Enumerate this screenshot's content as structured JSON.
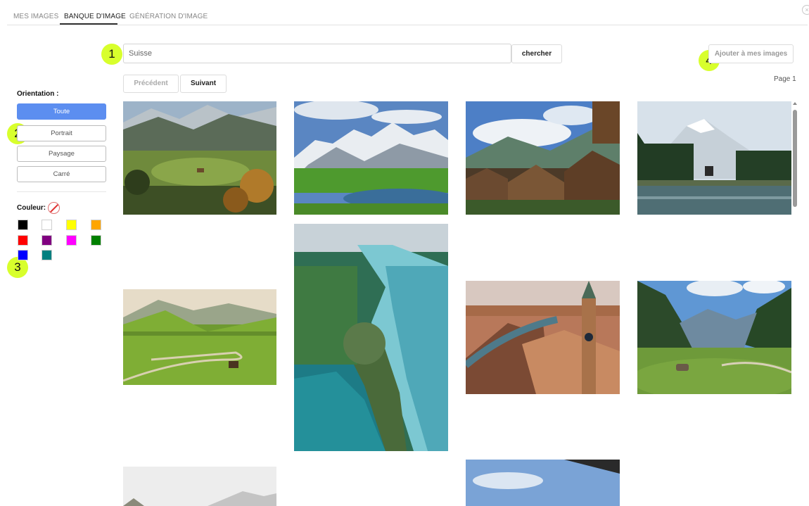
{
  "tabs": [
    {
      "label": "MES IMAGES"
    },
    {
      "label": "BANQUE D'IMAGE"
    },
    {
      "label": "GÉNÉRATION D'IMAGE"
    }
  ],
  "active_tab": "BANQUE D'IMAGE",
  "badges": [
    "1",
    "2",
    "3",
    "4"
  ],
  "search": {
    "value": "Suisse",
    "button_label": "chercher"
  },
  "add_button_label": "Ajouter à mes images",
  "pagination": {
    "prev_label": "Précédent",
    "next_label": "Suivant",
    "page_label": "Page 1"
  },
  "orientation": {
    "label": "Orientation :",
    "options": [
      {
        "label": "Toute",
        "selected": true
      },
      {
        "label": "Portrait",
        "selected": false
      },
      {
        "label": "Paysage",
        "selected": false
      },
      {
        "label": "Carré",
        "selected": false
      }
    ]
  },
  "color_filter": {
    "label": "Couleur:",
    "clear_icon": "no-color-icon",
    "swatches": [
      {
        "name": "black",
        "hex": "#000000"
      },
      {
        "name": "white",
        "hex": "#ffffff"
      },
      {
        "name": "yellow",
        "hex": "#ffff00"
      },
      {
        "name": "orange",
        "hex": "#ffa500"
      },
      {
        "name": "red",
        "hex": "#ff0000"
      },
      {
        "name": "purple",
        "hex": "#800080"
      },
      {
        "name": "magenta",
        "hex": "#ff00ff"
      },
      {
        "name": "green",
        "hex": "#008000"
      },
      {
        "name": "blue",
        "hex": "#0000ff"
      },
      {
        "name": "teal",
        "hex": "#008080"
      }
    ]
  },
  "gallery": [
    {
      "name": "photo-alpine-valley-autumn",
      "scene": "valley-autumn"
    },
    {
      "name": "photo-alpine-lake-snow-peaks",
      "scene": "lake-peaks"
    },
    {
      "name": "photo-mountain-village-chalets",
      "scene": "chalets"
    },
    {
      "name": "photo-mountain-forest-lake",
      "scene": "forest-lake"
    },
    {
      "name": "photo-green-hills-road",
      "scene": "green-hills"
    },
    {
      "name": "photo-aerial-turquoise-lake",
      "scene": "aerial-lake"
    },
    {
      "name": "photo-zurich-church-tower",
      "scene": "zurich"
    },
    {
      "name": "photo-valley-cow-pasture",
      "scene": "cow-valley"
    },
    {
      "name": "photo-snowy-mountain-partial",
      "scene": "snow-partial"
    },
    {
      "name": "photo-sky-partial",
      "scene": "sky-partial"
    }
  ]
}
